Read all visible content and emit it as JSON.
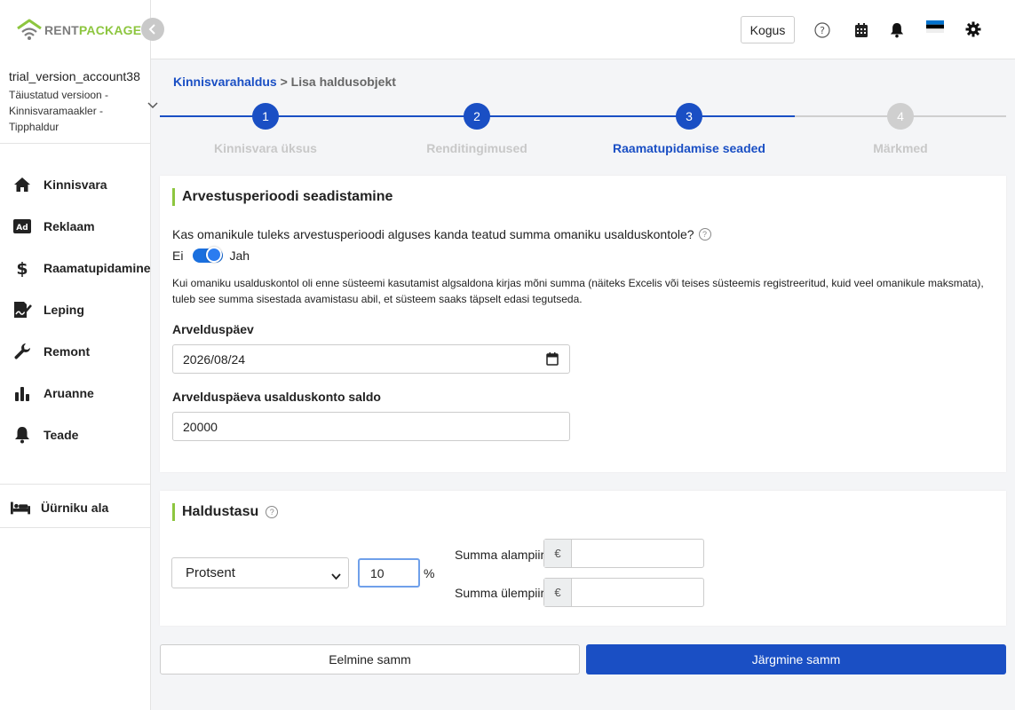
{
  "logo": {
    "part1": "RENT",
    "part2": "PACKAGE"
  },
  "account": {
    "name": "trial_version_account38",
    "sub": "Täiustatud versioon - Kinnisvaramaakler - Tipphaldur"
  },
  "sidebar": {
    "items": [
      {
        "label": "Kinnisvara",
        "icon": "home-icon"
      },
      {
        "label": "Reklaam",
        "icon": "ad-icon"
      },
      {
        "label": "Raamatupidamine",
        "icon": "dollar-icon"
      },
      {
        "label": "Leping",
        "icon": "contract-icon"
      },
      {
        "label": "Remont",
        "icon": "wrench-icon"
      },
      {
        "label": "Aruanne",
        "icon": "bar-chart-icon"
      },
      {
        "label": "Teade",
        "icon": "bell-icon"
      }
    ],
    "tenant": {
      "label": "Üürniku ala",
      "icon": "bed-icon"
    }
  },
  "header": {
    "kogus_label": "Kogus"
  },
  "breadcrumb": {
    "parent": "Kinnisvarahaldus",
    "separator": ">",
    "current": "Lisa haldusobjekt"
  },
  "stepper": {
    "steps": [
      {
        "number": "1",
        "label": "Kinnisvara üksus",
        "state": "done"
      },
      {
        "number": "2",
        "label": "Renditingimused",
        "state": "done"
      },
      {
        "number": "3",
        "label": "Raamatupidamise seaded",
        "state": "active"
      },
      {
        "number": "4",
        "label": "Märkmed",
        "state": "pending"
      }
    ]
  },
  "billing_card": {
    "title": "Arvestusperioodi seadistamine",
    "question": "Kas omanikule tuleks arvestusperioodi alguses kanda teatud summa omaniku usalduskontole?",
    "toggle_off_label": "Ei",
    "toggle_on_label": "Jah",
    "toggle_state": "on",
    "note": "Kui omaniku usalduskontol oli enne süsteemi kasutamist algsaldona kirjas mõni summa (näiteks Excelis või teises süsteemis registreeritud, kuid veel omanikule maksmata), tuleb see summa sisestada avamistasu abil, et süsteem saaks täpselt edasi tegutseda.",
    "date_label": "Arvelduspäev",
    "date_value": "2026/08/24",
    "balance_label": "Arvelduspäeva usalduskonto saldo",
    "balance_value": "20000"
  },
  "fee_card": {
    "title": "Haldustasu",
    "type_value": "Protsent",
    "percent_value": "10",
    "percent_sign": "%",
    "min_label": "Summa alampiir",
    "max_label": "Summa ülempiir",
    "currency": "€",
    "min_value": "",
    "max_value": ""
  },
  "buttons": {
    "prev": "Eelmine samm",
    "next": "Järgmine samm"
  },
  "colors": {
    "accent": "#1a4fc4",
    "brand_green": "#8dc63f",
    "step_pending": "#cfcfcf"
  }
}
